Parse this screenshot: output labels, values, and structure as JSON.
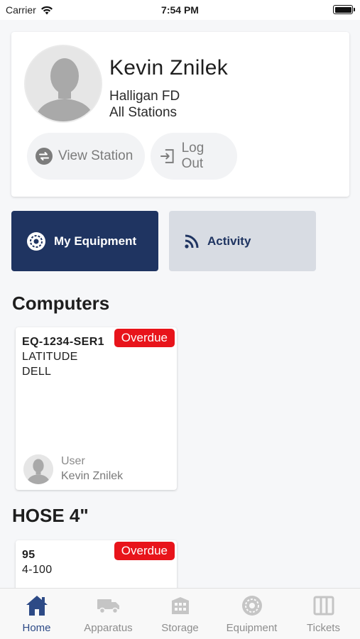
{
  "status_bar": {
    "carrier": "Carrier",
    "time": "7:54 PM"
  },
  "profile": {
    "name": "Kevin Znilek",
    "department": "Halligan FD",
    "stations": "All Stations",
    "view_station_label": "View Station",
    "logout_label": "Log Out"
  },
  "segments": {
    "equipment_label": "My Equipment",
    "activity_label": "Activity"
  },
  "sections": [
    {
      "title": "Computers",
      "items": [
        {
          "id": "EQ-1234-SER1",
          "line1": "LATITUDE",
          "line2": "DELL",
          "status": "Overdue",
          "user_label": "User",
          "user_name": "Kevin Znilek"
        }
      ]
    },
    {
      "title": "HOSE 4\"",
      "items": [
        {
          "id": "95",
          "line1": "4-100",
          "status": "Overdue"
        }
      ]
    }
  ],
  "tabs": [
    {
      "label": "Home",
      "icon": "home-icon",
      "active": true
    },
    {
      "label": "Apparatus",
      "icon": "truck-icon"
    },
    {
      "label": "Storage",
      "icon": "storage-icon"
    },
    {
      "label": "Equipment",
      "icon": "gear-icon"
    },
    {
      "label": "Tickets",
      "icon": "tickets-icon"
    }
  ],
  "colors": {
    "primary": "#1f3461",
    "badge": "#e8141b",
    "tab_active": "#2d4a86",
    "tab_inactive": "#8e8e8e"
  }
}
